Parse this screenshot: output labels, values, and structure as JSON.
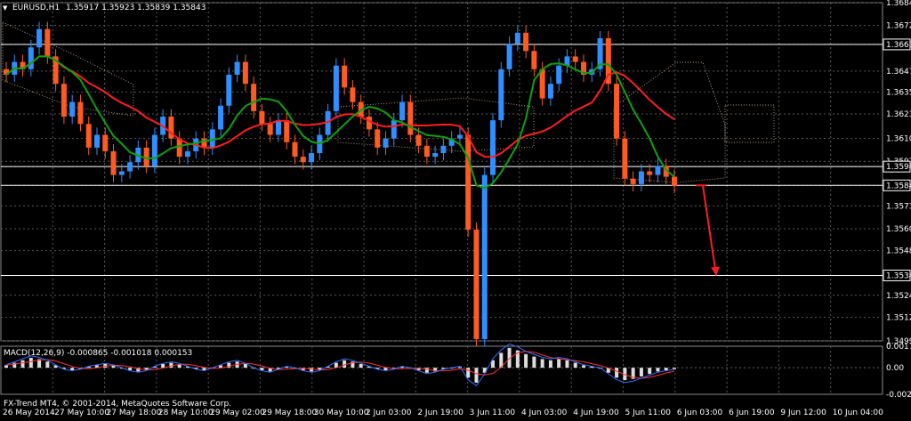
{
  "header": {
    "arrow_glyph": "▼",
    "symbol": "EURUSD,H1",
    "ohlc": "1.35917 1.35923 1.35839 1.35843"
  },
  "macd": {
    "label": "MACD(12,26,9) -0.000865 -0.001018 0.000153",
    "scale_ticks": [
      "0.001732",
      "0.00",
      "-0.002136"
    ]
  },
  "copyright": "FX-Trend MT4, © 2001-2014, MetaQuotes Software Corp.",
  "chart_data": {
    "type": "candlestick",
    "symbol": "EURUSD",
    "timeframe": "H1",
    "price_scale_ticks": [
      "1.36845",
      "1.36720",
      "1.36616",
      "1.36470",
      "1.36355",
      "1.36235",
      "1.36100",
      "1.35975",
      "1.35946",
      "1.35843",
      "1.35730",
      "1.35605",
      "1.35485",
      "1.35349",
      "1.35240",
      "1.35120",
      "1.34990"
    ],
    "highlighted_levels": [
      "1.36616",
      "1.35946",
      "1.35843",
      "1.35349"
    ],
    "ylim": [
      1.3499,
      1.36845
    ],
    "time_ticks": [
      "26 May 2014",
      "27 May 10:00",
      "27 May 18:00",
      "28 May 10:00",
      "29 May 02:00",
      "29 May 18:00",
      "30 May 10:00",
      "2 Jun 03:00",
      "2 Jun 19:00",
      "3 Jun 11:00",
      "4 Jun 03:00",
      "4 Jun 19:00",
      "5 Jun 11:00",
      "6 Jun 03:00",
      "6 Jun 19:00",
      "9 Jun 12:00",
      "10 Jun 04:00"
    ],
    "price_path": [
      1.3645,
      1.3652,
      1.3648,
      1.366,
      1.367,
      1.3655,
      1.364,
      1.3622,
      1.363,
      1.3618,
      1.3605,
      1.3612,
      1.3603,
      1.359,
      1.3592,
      1.3597,
      1.3605,
      1.3595,
      1.3612,
      1.3622,
      1.361,
      1.36,
      1.3603,
      1.361,
      1.3605,
      1.3615,
      1.3628,
      1.3645,
      1.3652,
      1.364,
      1.3625,
      1.3618,
      1.3612,
      1.362,
      1.3608,
      1.36,
      1.3597,
      1.3602,
      1.3612,
      1.3625,
      1.365,
      1.3638,
      1.363,
      1.3622,
      1.3615,
      1.3605,
      1.361,
      1.362,
      1.363,
      1.3612,
      1.3606,
      1.36,
      1.3602,
      1.3606,
      1.361,
      1.3612,
      1.356,
      1.35,
      1.359,
      1.362,
      1.3648,
      1.3662,
      1.3668,
      1.3658,
      1.3648,
      1.3632,
      1.364,
      1.365,
      1.3655,
      1.3652,
      1.3645,
      1.3648,
      1.3665,
      1.364,
      1.361,
      1.3588,
      1.3585,
      1.3592,
      1.359,
      1.3595,
      1.3589,
      1.3584
    ],
    "macd_hist": [
      0.0002,
      0.0004,
      0.0006,
      0.0008,
      0.0007,
      0.0005,
      0.0002,
      -0.0001,
      -0.0002,
      -0.0001,
      0.0001,
      0.0002,
      0.0003,
      0.0002,
      0.0,
      -0.0002,
      -0.0003,
      -0.0002,
      0.0001,
      0.0003,
      0.0004,
      0.0003,
      0.0001,
      -0.0001,
      -0.0002,
      0.0,
      0.0002,
      0.0004,
      0.0005,
      0.0003,
      0.0,
      -0.0002,
      -0.0003,
      -0.0001,
      0.0001,
      0.0,
      -0.0002,
      -0.0003,
      -0.0002,
      0.0001,
      0.0004,
      0.0006,
      0.0005,
      0.0003,
      0.0001,
      -0.0001,
      -0.0002,
      -0.0001,
      0.0001,
      0.0,
      -0.0002,
      -0.0004,
      -0.0003,
      -0.0001,
      0.0,
      0.0001,
      -0.0008,
      -0.0012,
      -0.0004,
      0.0006,
      0.0012,
      0.0016,
      0.0014,
      0.0011,
      0.0009,
      0.0007,
      0.0006,
      0.0007,
      0.0006,
      0.0004,
      0.0002,
      0.0001,
      0.0,
      -0.0004,
      -0.0008,
      -0.001,
      -0.0009,
      -0.0007,
      -0.0005,
      -0.0003,
      -0.0002,
      -0.0001
    ],
    "macd_ylim": [
      -0.002136,
      0.001732
    ],
    "colors": {
      "bull": "#2f8fff",
      "bear": "#ff5a1f",
      "ma_red": "#ff1e1e",
      "ma_green": "#0fa00f",
      "cloud": "#ffd7b4",
      "grid": "#5a5a5a",
      "level": "#ffffff",
      "signal_arrow": "#ff1e1e"
    }
  }
}
